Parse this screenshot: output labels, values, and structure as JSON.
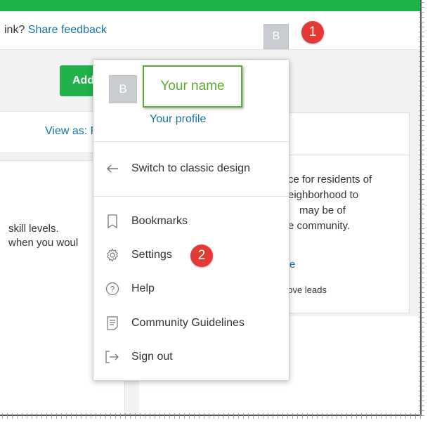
{
  "topbar": {
    "feedback_prefix": "ink? ",
    "feedback_link": "Share feedback",
    "avatar_initial": "B",
    "badge_1": "1"
  },
  "background": {
    "add_button": "Add",
    "view_as": "View as: Fe",
    "skill_line_1": "skill levels.",
    "skill_line_2": "when you woul",
    "right_line_1": "ce for residents of",
    "right_line_2": "eighborhood to",
    "right_line_3": "may be of",
    "right_line_4": "e community.",
    "right_link": "e",
    "right_small": "rove leads"
  },
  "menu": {
    "avatar_initial": "B",
    "name": "Your name",
    "profile_link": "Your profile",
    "items": [
      {
        "label": "Switch to classic design",
        "icon": "arrow-left-icon"
      },
      {
        "label": "Bookmarks",
        "icon": "bookmark-icon"
      },
      {
        "label": "Settings",
        "icon": "gear-icon"
      },
      {
        "label": "Help",
        "icon": "help-icon"
      },
      {
        "label": "Community Guidelines",
        "icon": "document-icon"
      },
      {
        "label": "Sign out",
        "icon": "sign-out-icon"
      }
    ],
    "badge_2": "2"
  },
  "colors": {
    "brand_green": "#1fb14a",
    "link_blue": "#1a73a8",
    "highlight_green": "#5aab2f",
    "badge_red": "#e53935"
  }
}
